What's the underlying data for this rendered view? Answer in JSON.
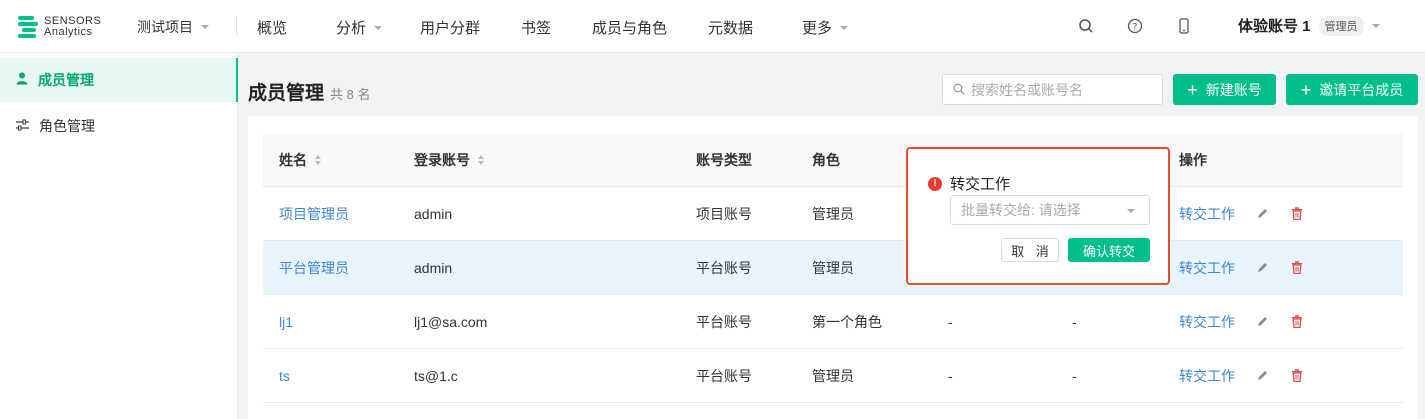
{
  "brand": {
    "line1": "SENSORS",
    "line2": "Analytics",
    "accent": "#00bf8a"
  },
  "topbar": {
    "project": "测试项目",
    "nav": [
      {
        "label": "概览",
        "has_dropdown": false
      },
      {
        "label": "分析",
        "has_dropdown": true
      },
      {
        "label": "用户分群",
        "has_dropdown": false
      },
      {
        "label": "书签",
        "has_dropdown": false
      },
      {
        "label": "成员与角色",
        "has_dropdown": false
      },
      {
        "label": "元数据",
        "has_dropdown": false
      },
      {
        "label": "更多",
        "has_dropdown": true
      }
    ],
    "icons": [
      "search-icon",
      "help-icon",
      "mobile-icon"
    ],
    "account_name": "体验账号 1",
    "account_role": "管理员"
  },
  "sidebar": {
    "items": [
      {
        "label": "成员管理",
        "icon": "user-icon",
        "active": true
      },
      {
        "label": "角色管理",
        "icon": "sliders-icon",
        "active": false
      }
    ]
  },
  "page": {
    "title": "成员管理",
    "count": "共 8 名",
    "search_placeholder": "搜索姓名或账号名",
    "new_account_label": "新建账号",
    "invite_label": "邀请平台成员"
  },
  "table": {
    "columns": [
      "姓名",
      "登录账号",
      "账号类型",
      "角色",
      "",
      "",
      "操作"
    ],
    "rows": [
      {
        "name": "项目管理员",
        "login": "admin",
        "type": "项目账号",
        "role": "管理员",
        "c5": "",
        "c6": "",
        "action": "转交工作"
      },
      {
        "name": "平台管理员",
        "login": "admin",
        "type": "平台账号",
        "role": "管理员",
        "c5": "",
        "c6": "",
        "action": "转交工作"
      },
      {
        "name": "lj1",
        "login": "lj1@sa.com",
        "type": "平台账号",
        "role": "第一个角色",
        "c5": "-",
        "c6": "-",
        "action": "转交工作"
      },
      {
        "name": "ts",
        "login": "ts@1.c",
        "type": "平台账号",
        "role": "管理员",
        "c5": "-",
        "c6": "-",
        "action": "转交工作"
      }
    ]
  },
  "popover": {
    "title": "转交工作",
    "select_placeholder": "批量转交给: 请选择",
    "cancel_label": "取 消",
    "confirm_label": "确认转交",
    "highlight_color": "#e74c2b"
  }
}
